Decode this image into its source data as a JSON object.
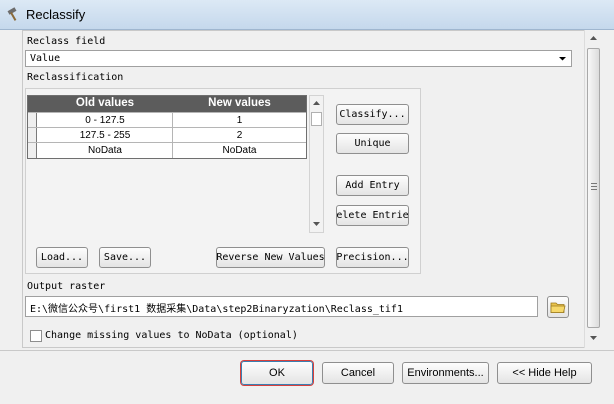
{
  "window": {
    "title": "Reclassify"
  },
  "reclass_field": {
    "label": "Reclass field",
    "value": "Value"
  },
  "reclassification": {
    "label": "Reclassification",
    "columns": [
      "Old values",
      "New values"
    ],
    "rows": [
      {
        "old": "0 - 127.5",
        "new": "1"
      },
      {
        "old": "127.5 - 255",
        "new": "2"
      },
      {
        "old": "NoData",
        "new": "NoData"
      }
    ]
  },
  "side_buttons": {
    "classify": "Classify...",
    "unique": "Unique",
    "add_entry": "Add Entry",
    "delete_entries": "elete Entrie"
  },
  "bottom_buttons": {
    "load": "Load...",
    "save": "Save...",
    "reverse": "Reverse New Values",
    "precision": "Precision..."
  },
  "output_raster": {
    "label": "Output raster",
    "value": "E:\\微信公众号\\first1 数据采集\\Data\\step2Binaryzation\\Reclass_tif1"
  },
  "missing": {
    "label": "Change missing values to NoData (optional)",
    "checked": false
  },
  "footer": {
    "ok": "OK",
    "cancel": "Cancel",
    "environments": "Environments...",
    "hide_help": "<< Hide Help"
  }
}
